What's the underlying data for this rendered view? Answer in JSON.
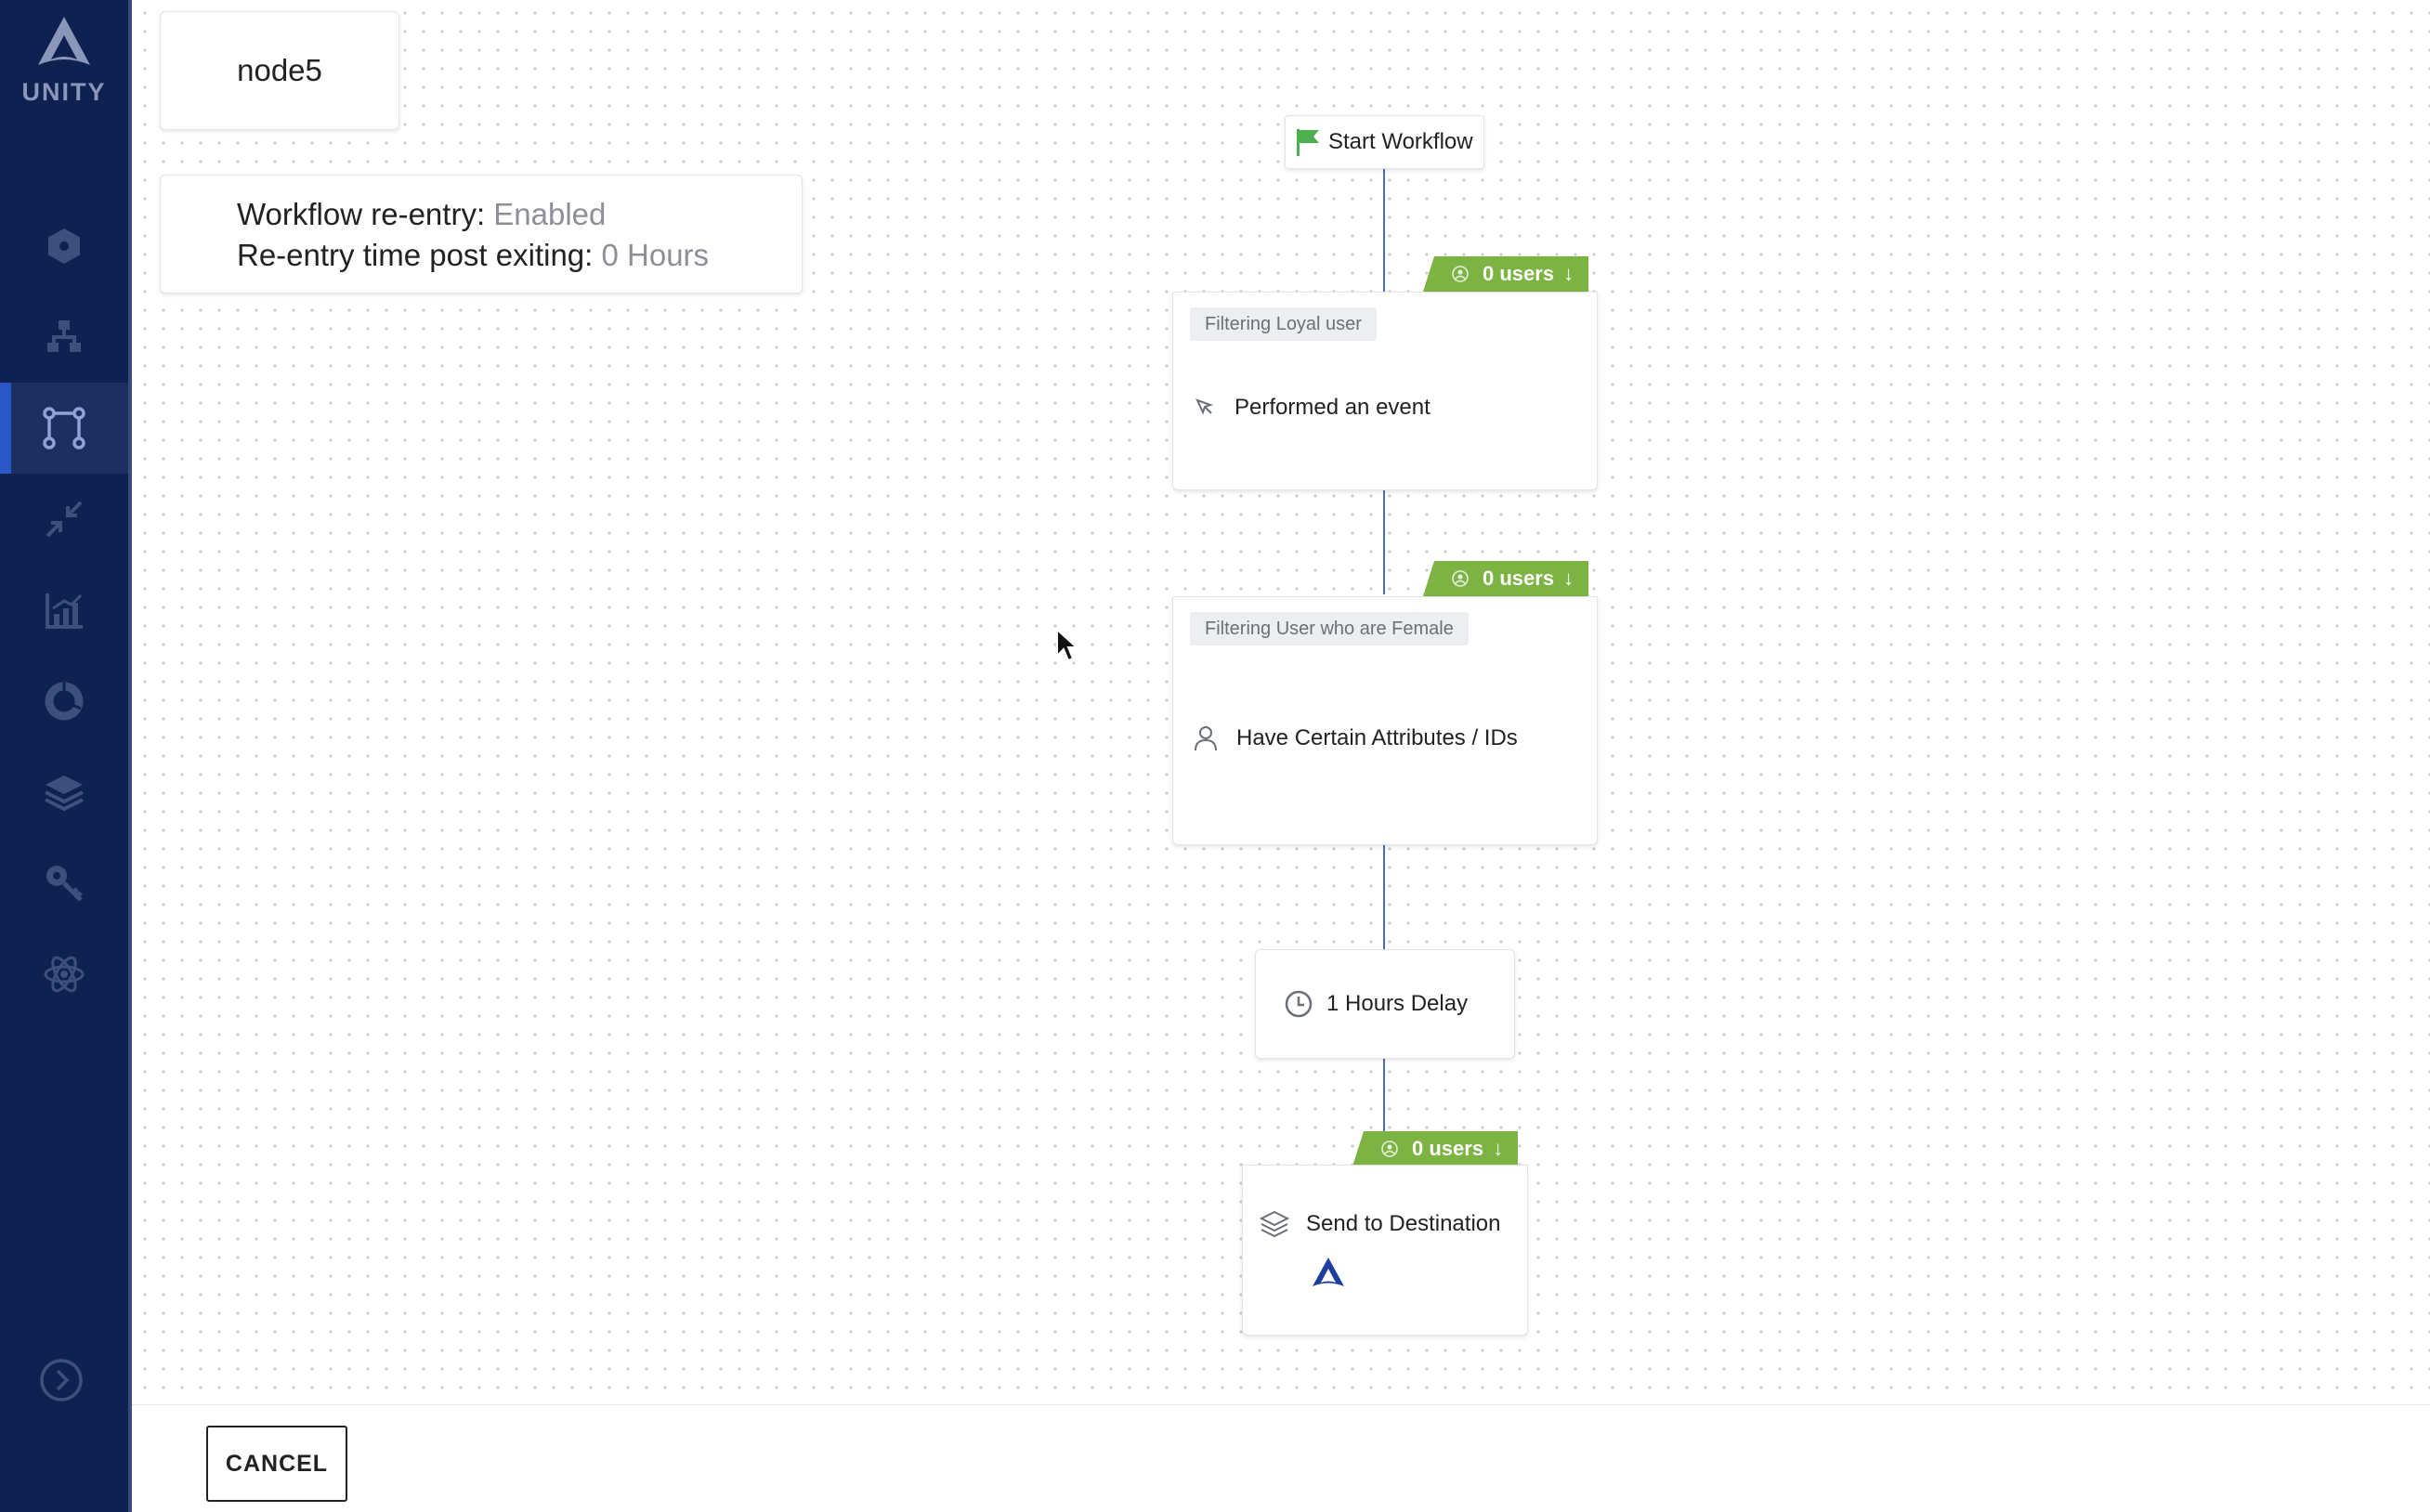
{
  "app": {
    "brand_name": "UNITY"
  },
  "sidebar": {
    "items": [
      {
        "icon": "hexagon-icon",
        "active": false
      },
      {
        "icon": "hierarchy-icon",
        "active": false
      },
      {
        "icon": "workflow-icon",
        "active": true
      },
      {
        "icon": "merge-arrows-icon",
        "active": false
      },
      {
        "icon": "analytics-chart-icon",
        "active": false
      },
      {
        "icon": "donut-chart-icon",
        "active": false
      },
      {
        "icon": "layers-icon",
        "active": false
      },
      {
        "icon": "key-search-icon",
        "active": false
      },
      {
        "icon": "atom-icon",
        "active": false
      }
    ],
    "expand_icon": "chevron-right-circle-icon"
  },
  "workflow": {
    "node_name": "node5",
    "reentry_label": "Workflow re-entry: ",
    "reentry_value": "Enabled",
    "reentry_time_label": "Re-entry time post exiting: ",
    "reentry_time_value": "0 Hours",
    "start_label": "Start Workflow",
    "nodes": [
      {
        "users_badge": "0 users",
        "filter_name": "Filtering Loyal user",
        "condition": "Performed an event",
        "icon": "cursor-click-icon"
      },
      {
        "users_badge": "0 users",
        "filter_name": "Filtering User who are Female",
        "condition": "Have Certain Attributes / IDs",
        "icon": "person-icon"
      }
    ],
    "delay": {
      "label": "1 Hours Delay",
      "icon": "clock-icon"
    },
    "destination": {
      "users_badge": "0 users",
      "label": "Send to Destination",
      "icon": "layers-icon"
    }
  },
  "footer": {
    "cancel_label": "CANCEL"
  },
  "colors": {
    "sidebar_bg": "#0f2150",
    "badge_green": "#7cb342",
    "connector_blue": "#4a6fb3",
    "flag_green": "#4caf50"
  }
}
